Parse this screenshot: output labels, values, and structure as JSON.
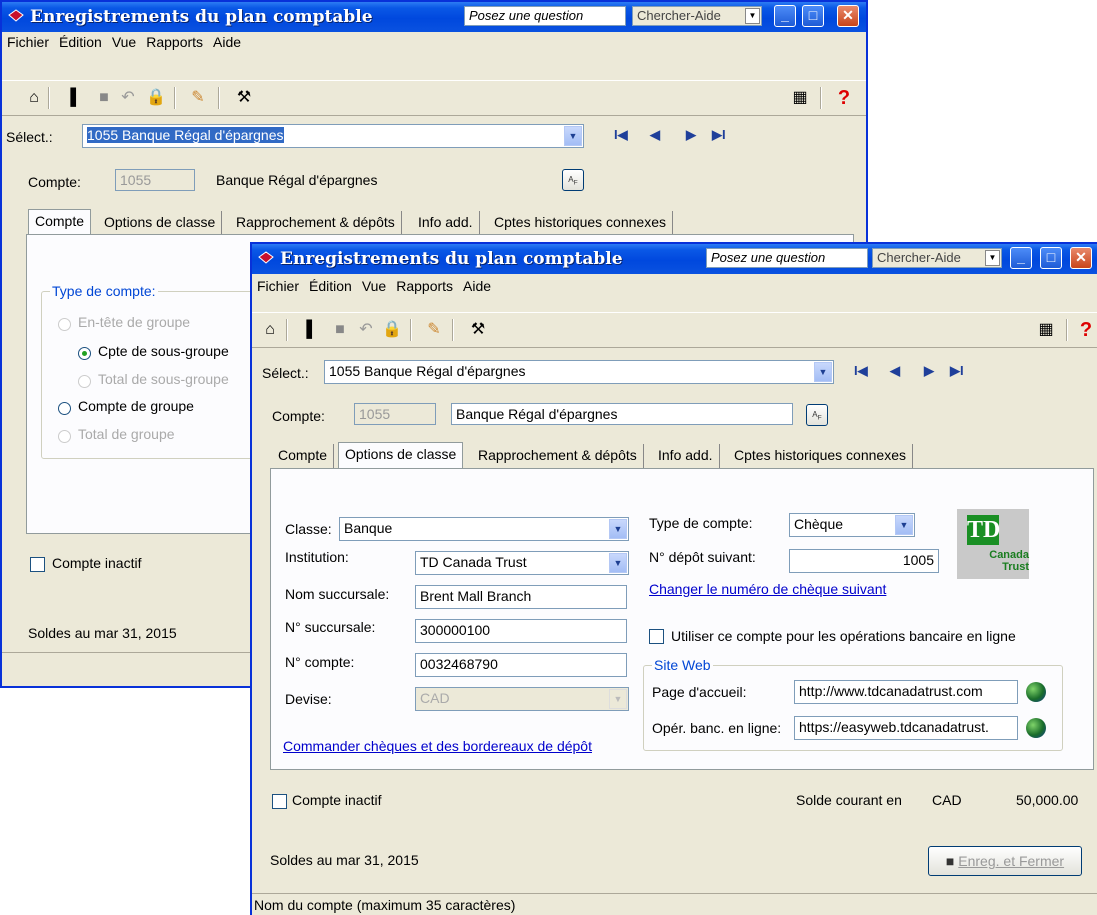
{
  "back_window": {
    "title": "Enregistrements du plan comptable",
    "ask_placeholder": "Posez une question",
    "help_button": "Chercher-Aide",
    "menu": [
      "Fichier",
      "Édition",
      "Vue",
      "Rapports",
      "Aide"
    ],
    "select_label": "Sélect.:",
    "select_value": "1055 Banque Régal d'épargnes",
    "compte_label": "Compte:",
    "compte_number": "1055",
    "compte_name": "Banque Régal d'épargnes",
    "lang_button": "An Fr",
    "tabs": [
      "Compte",
      "Options de classe",
      "Rapprochement & dépôts",
      "Info add.",
      "Cptes historiques connexes"
    ],
    "active_tab": "Compte",
    "account_type_group": "Type de compte:",
    "radios": [
      {
        "label": "En-tête de groupe",
        "enabled": false,
        "selected": false
      },
      {
        "label": "Cpte de sous-groupe",
        "enabled": true,
        "selected": true
      },
      {
        "label": "Total de sous-groupe",
        "enabled": false,
        "selected": false
      },
      {
        "label": "Compte de groupe",
        "enabled": true,
        "selected": false
      },
      {
        "label": "Total de groupe",
        "enabled": false,
        "selected": false
      }
    ],
    "inactive_label": "Compte inactif",
    "balances_label": "Soldes au mar 31, 2015"
  },
  "front_window": {
    "title": "Enregistrements du plan comptable",
    "ask_placeholder": "Posez une question",
    "help_button": "Chercher-Aide",
    "menu": [
      "Fichier",
      "Édition",
      "Vue",
      "Rapports",
      "Aide"
    ],
    "select_label": "Sélect.:",
    "select_value": "1055 Banque Régal d'épargnes",
    "compte_label": "Compte:",
    "compte_number": "1055",
    "compte_name": "Banque Régal d'épargnes",
    "lang_button": "An Fr",
    "tabs": [
      "Compte",
      "Options de classe",
      "Rapprochement & dépôts",
      "Info add.",
      "Cptes historiques connexes"
    ],
    "active_tab": "Options de classe",
    "form": {
      "classe_label": "Classe:",
      "classe_value": "Banque",
      "institution_label": "Institution:",
      "institution_value": "TD Canada Trust",
      "nom_succursale_label": "Nom succursale:",
      "nom_succursale_value": "Brent Mall Branch",
      "no_succursale_label": "N° succursale:",
      "no_succursale_value": "300000100",
      "no_compte_label": "N° compte:",
      "no_compte_value": "0032468790",
      "devise_label": "Devise:",
      "devise_value": "CAD",
      "order_link": "Commander  chèques et des bordereaux de dépôt",
      "type_compte_label": "Type de compte:",
      "type_compte_value": "Chèque",
      "depot_suivant_label": "N° dépôt suivant:",
      "depot_suivant_value": "1005",
      "change_cheque_link": "Changer le numéro de chèque suivant",
      "online_banking_label": "Utiliser ce compte pour les opérations bancaire en ligne",
      "website_group": "Site Web",
      "homepage_label": "Page d'accueil:",
      "homepage_value": "http://www.tdcanadatrust.com",
      "online_label": "Opér. banc. en ligne:",
      "online_value": "https://easyweb.tdcanadatrust.",
      "logo_td": "TD",
      "logo_canada": "Canada",
      "logo_trust": "Trust"
    },
    "inactive_label": "Compte inactif",
    "current_balance_label": "Solde courant en",
    "current_balance_currency": "CAD",
    "current_balance_value": "50,000.00",
    "balances_label": "Soldes au mar 31, 2015",
    "save_close_button": "Enreg. et Fermer",
    "status_text": "Nom du compte (maximum 35 caractères)"
  }
}
